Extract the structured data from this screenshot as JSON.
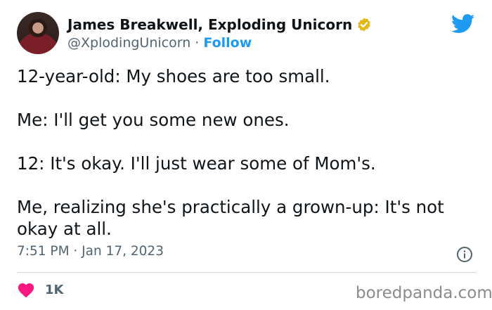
{
  "author": {
    "name": "James Breakwell, Exploding Unicorn",
    "handle": "@XplodingUnicorn",
    "separator": " · ",
    "follow_label": "Follow"
  },
  "tweet": {
    "lines": [
      "12-year-old: My shoes are too small.",
      "Me: I'll get you some new ones.",
      "12: It's okay. I'll just wear some of Mom's.",
      "Me, realizing she's practically a grown-up: It's not okay at all."
    ],
    "timestamp": "7:51 PM · Jan 17, 2023"
  },
  "engagement": {
    "likes": "1K"
  },
  "watermark": "boredpanda.com",
  "icons": {
    "verified": "verified-badge-icon",
    "twitter": "twitter-bird-icon",
    "info": "info-icon",
    "like": "heart-icon"
  },
  "colors": {
    "accent": "#1d9bf0",
    "heart": "#f91880",
    "verified": "#e2b719",
    "muted": "#536471"
  }
}
